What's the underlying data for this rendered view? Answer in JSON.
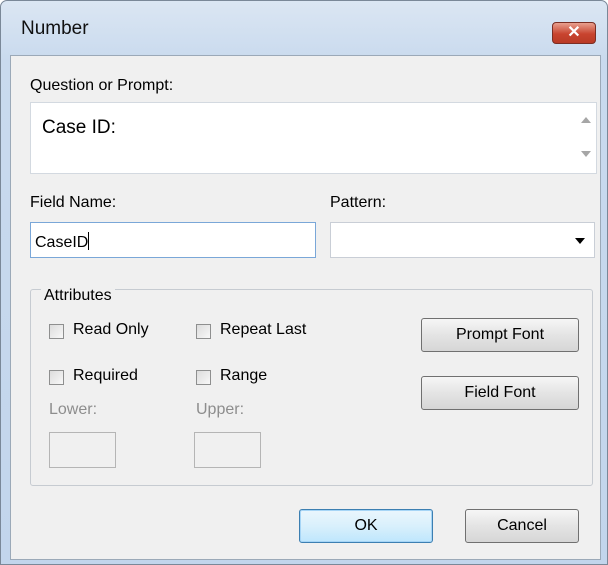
{
  "window": {
    "title": "Number",
    "close_glyph": "✕"
  },
  "prompt": {
    "label": "Question or Prompt:",
    "value": "Case ID:"
  },
  "field_name": {
    "label": "Field Name:",
    "value": "CaseID"
  },
  "pattern": {
    "label": "Pattern:",
    "value": ""
  },
  "attributes": {
    "label": "Attributes",
    "read_only": {
      "label": "Read Only",
      "checked": false
    },
    "repeat_last": {
      "label": "Repeat Last",
      "checked": false
    },
    "required": {
      "label": "Required",
      "checked": false
    },
    "range": {
      "label": "Range",
      "checked": false
    },
    "lower": {
      "label": "Lower:",
      "value": ""
    },
    "upper": {
      "label": "Upper:",
      "value": ""
    },
    "prompt_font_label": "Prompt Font",
    "field_font_label": "Field Font"
  },
  "buttons": {
    "ok": "OK",
    "cancel": "Cancel"
  },
  "icons": {
    "dropdown": "chevron-down-icon",
    "close": "close-icon"
  }
}
